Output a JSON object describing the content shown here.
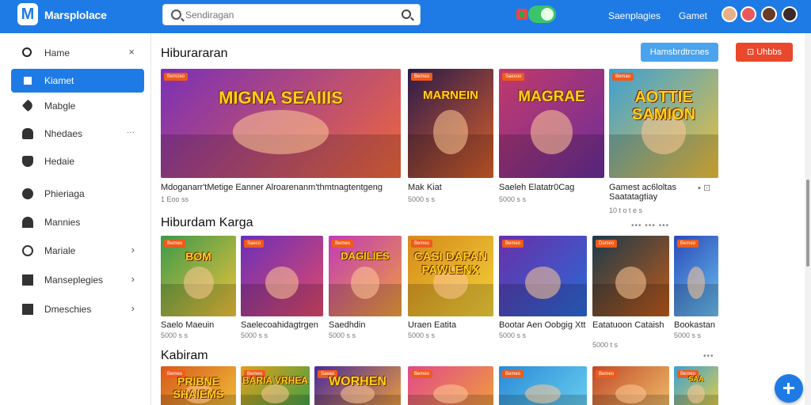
{
  "header": {
    "logo_letter": "M",
    "brand": "Marsplolace",
    "search": {
      "placeholder": "Sendiragan"
    },
    "links": [
      "Saenplagies",
      "Gamet"
    ],
    "colors": {
      "primary": "#1e7be6",
      "accent_red": "#e9482c",
      "accent_blue": "#4aa3ee",
      "toggle_green": "#3cc46a"
    }
  },
  "sidebar": {
    "items": [
      {
        "label": "Hame",
        "icon": "search-icon",
        "trail": "×",
        "active": false
      },
      {
        "label": "Kiamet",
        "icon": "square-icon",
        "trail": "",
        "active": true
      },
      {
        "label": "Mabgle",
        "icon": "tag-icon",
        "trail": "",
        "active": false
      },
      {
        "label": "Nhedaes",
        "icon": "home-icon",
        "trail": "···",
        "active": false
      },
      {
        "label": "Hedaie",
        "icon": "shield-icon",
        "trail": "",
        "active": false
      },
      {
        "label": "Phieriaga",
        "icon": "person-icon",
        "trail": "",
        "active": false
      },
      {
        "label": "Mannies",
        "icon": "document-icon",
        "trail": "",
        "active": false
      },
      {
        "label": "Mariale",
        "icon": "circle-icon",
        "trail": "›",
        "active": false
      },
      {
        "label": "Manseplegies",
        "icon": "check-icon",
        "trail": "›",
        "active": false
      },
      {
        "label": "Dmeschies",
        "icon": "list-icon",
        "trail": "›",
        "active": false
      }
    ]
  },
  "main": {
    "sections": [
      {
        "title": "Hiburararan",
        "more": "",
        "buttons": {
          "primary": "Hamsbrdtrcnes",
          "secondary": "⊡ Uhbbs"
        },
        "cards": [
          {
            "title": "Mdoganarr'tMetige Eanner Alroarenanm'thmtnagtentgeng",
            "sub": "1 Eoo ss",
            "badge": "Bemzeo",
            "art": "MIGNA SEAIIIS",
            "bg": "#7b2fb8",
            "bg2": "#f0683a"
          },
          {
            "title": "Mak Kiat",
            "sub": "5000 s s",
            "badge": "Bemeo",
            "art": "MARNEIN",
            "bg": "#2b1a4a",
            "bg2": "#d8602a"
          },
          {
            "title": "Saeleh Elatatr0Cag",
            "sub": "5000 s s",
            "badge": "Saesoo",
            "art": "MAGRAE",
            "bg": "#c2396a",
            "bg2": "#6b2e9a"
          },
          {
            "title": "Gamest ac6loltas Saatatagtiay",
            "sub": "10 t o t e s",
            "badge": "Bemao",
            "art": "AOTTIE SAMION",
            "bg": "#3aa0d6",
            "bg2": "#f0c03a",
            "extra": "▪ ⊡"
          }
        ]
      },
      {
        "title": "Hiburdam Karga",
        "more": "••• ••• •••",
        "cards": [
          {
            "title": "Saelo Maeuin",
            "sub": "5000 s s",
            "badge": "Bemeo",
            "art": "BOM",
            "bg": "#3b9a4a",
            "bg2": "#f0c23a"
          },
          {
            "title": "Saelecoahidagtrgen",
            "sub": "5000 s s",
            "badge": "Saeco",
            "art": "",
            "bg": "#6b2fb8",
            "bg2": "#e04a6a"
          },
          {
            "title": "Saedhdin",
            "sub": "5000 s s",
            "badge": "Bemeo",
            "art": "DAGILIES",
            "bg": "#c03ab8",
            "bg2": "#f0a03a"
          },
          {
            "title": "Uraen Eatita",
            "sub": "5000 s s",
            "badge": "Bemeo",
            "art": "CASI DAPAN PAWLENX",
            "bg": "#d6891a",
            "bg2": "#f2d23a"
          },
          {
            "title": "Bootar Aen Oobgig Xtt",
            "sub": "5000 s s",
            "badge": "Bemeo",
            "art": "",
            "bg": "#6a2fa8",
            "bg2": "#2a6ad6"
          },
          {
            "title": "Eatatuoon Cataish",
            "sub": "5000 t s",
            "badge": "Dameo",
            "art": "",
            "bg": "#1a3a4a",
            "bg2": "#c05a1a"
          },
          {
            "title": "Bookastan",
            "sub": "5000 s s",
            "badge": "Bemeo",
            "art": "",
            "bg": "#2a4ab8",
            "bg2": "#6ac0f0"
          }
        ]
      },
      {
        "title": "Kabiram",
        "more": "•••",
        "cards": [
          {
            "title": "",
            "sub": "",
            "badge": "Bemeo",
            "art": "PRIBNE SHAIEMS",
            "bg": "#d65a1a",
            "bg2": "#f0c03a"
          },
          {
            "title": "",
            "sub": "",
            "badge": "Bemeo",
            "art": "BARIA VRHEA",
            "bg": "#e0a01a",
            "bg2": "#3aa04a"
          },
          {
            "title": "",
            "sub": "",
            "badge": "Saeeo",
            "art": "WORHEN",
            "bg": "#4a2a9a",
            "bg2": "#f0a03a"
          },
          {
            "title": "",
            "sub": "",
            "badge": "Bemeo",
            "art": "",
            "bg": "#e04a8a",
            "bg2": "#f0a03a"
          },
          {
            "title": "",
            "sub": "",
            "badge": "Bemeo",
            "art": "",
            "bg": "#2a8ad6",
            "bg2": "#6ad0f0"
          },
          {
            "title": "",
            "sub": "",
            "badge": "Bemeo",
            "art": "",
            "bg": "#c04a2a",
            "bg2": "#f0c06a"
          },
          {
            "title": "",
            "sub": "",
            "badge": "Bemeo",
            "art": "SAA",
            "bg": "#3aa0d6",
            "bg2": "#f0d03a"
          }
        ]
      }
    ]
  }
}
